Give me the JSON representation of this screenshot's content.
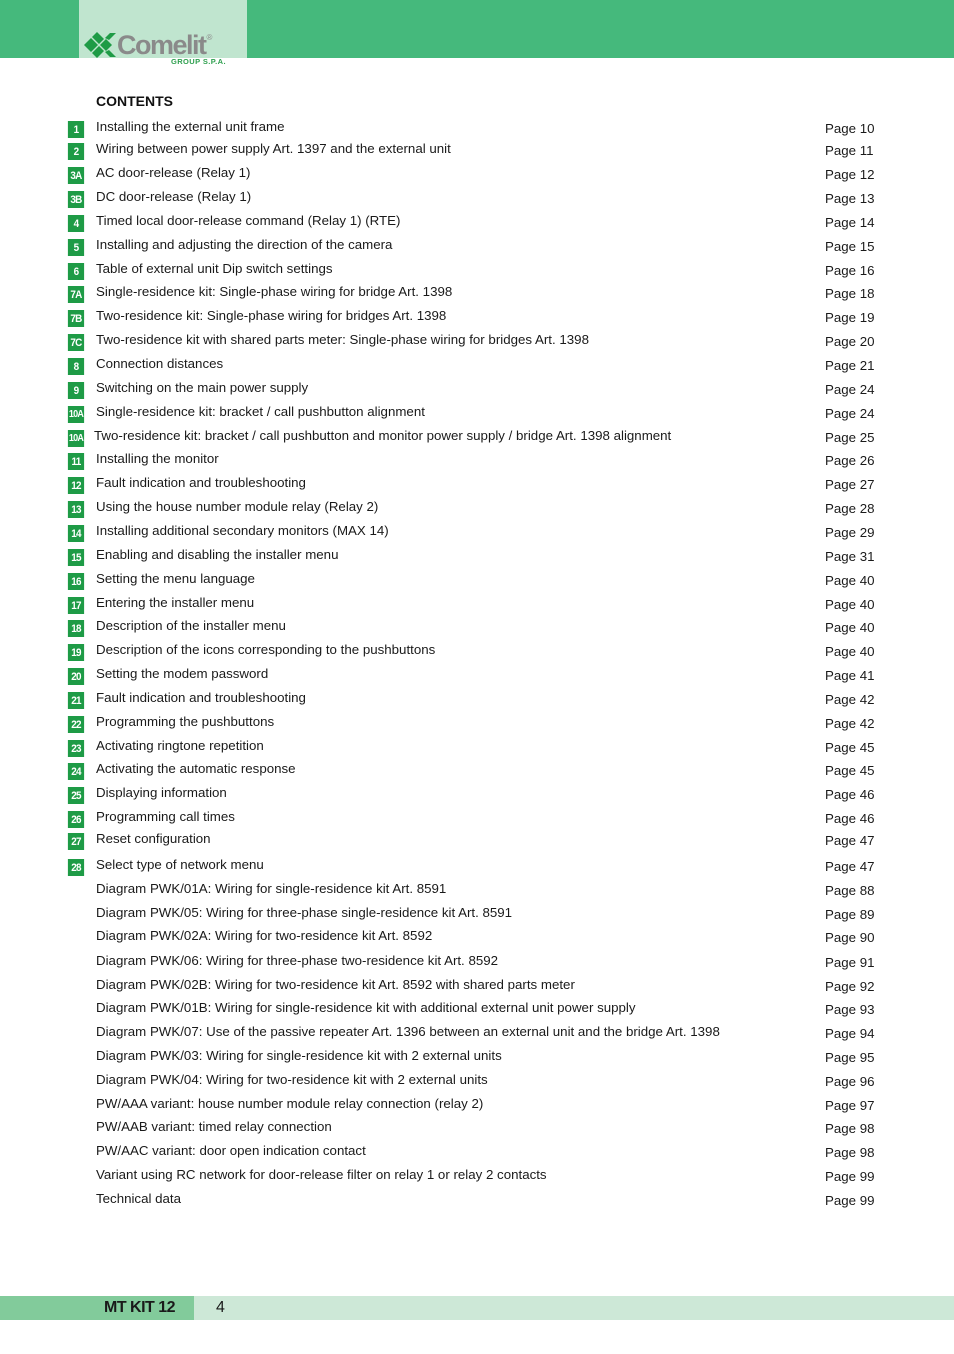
{
  "header": {
    "brand": "Comelit",
    "brand_mark": "®",
    "brand_sub": "GROUP S.P.A.",
    "colors": {
      "band": "#45b97c",
      "logo_bg": "#c0e5cf",
      "badge": "#1e9b46",
      "footer_dark": "#82cb9b",
      "footer_light": "#cde8d7"
    }
  },
  "contents": {
    "title": "CONTENTS",
    "entries": [
      {
        "num": "1",
        "title": "Installing the external unit frame",
        "page": "Page 10"
      },
      {
        "num": "2",
        "title": "Wiring between power supply Art. 1397 and the external unit",
        "page": "Page 11"
      },
      {
        "num": "3A",
        "title": "AC door-release (Relay 1)",
        "page": "Page 12"
      },
      {
        "num": "3B",
        "title": "DC door-release (Relay 1)",
        "page": "Page 13"
      },
      {
        "num": "4",
        "title": "Timed local door-release command (Relay 1) (RTE)",
        "page": "Page 14"
      },
      {
        "num": "5",
        "title": "Installing and adjusting the direction of the camera",
        "page": "Page 15"
      },
      {
        "num": "6",
        "title": "Table of external unit Dip switch settings",
        "page": "Page 16"
      },
      {
        "num": "7A",
        "title": "Single-residence kit: Single-phase wiring for bridge Art. 1398",
        "page": "Page 18"
      },
      {
        "num": "7B",
        "title": "Two-residence kit: Single-phase wiring for bridges Art. 1398",
        "page": "Page 19"
      },
      {
        "num": "7C",
        "title": "Two-residence kit with shared parts meter: Single-phase wiring for bridges Art. 1398",
        "page": "Page 20"
      },
      {
        "num": "8",
        "title": "Connection distances",
        "page": "Page 21"
      },
      {
        "num": "9",
        "title": "Switching on the main power supply",
        "page": "Page 24"
      },
      {
        "num": "10A",
        "title": "Single-residence kit: bracket / call pushbutton alignment",
        "page": "Page 24"
      },
      {
        "num": "10A",
        "title": "Two-residence kit: bracket / call pushbutton and monitor power supply / bridge Art. 1398 alignment",
        "page": "Page 25"
      },
      {
        "num": "11",
        "title": "Installing the monitor",
        "page": "Page 26"
      },
      {
        "num": "12",
        "title": "Fault indication and troubleshooting",
        "page": "Page 27"
      },
      {
        "num": "13",
        "title": "Using the house number module relay (Relay 2)",
        "page": "Page 28"
      },
      {
        "num": "14",
        "title": "Installing additional secondary monitors (MAX 14)",
        "page": "Page 29"
      },
      {
        "num": "15",
        "title": "Enabling and disabling the installer menu",
        "page": "Page 31"
      },
      {
        "num": "16",
        "title": "Setting the menu language",
        "page": "Page 40"
      },
      {
        "num": "17",
        "title": "Entering the installer menu",
        "page": "Page 40"
      },
      {
        "num": "18",
        "title": "Description of the installer menu",
        "page": "Page 40"
      },
      {
        "num": "19",
        "title": "Description of the icons corresponding to the pushbuttons",
        "page": "Page 40"
      },
      {
        "num": "20",
        "title": "Setting the modem password",
        "page": "Page 41"
      },
      {
        "num": "21",
        "title": "Fault indication and troubleshooting",
        "page": "Page 42"
      },
      {
        "num": "22",
        "title": "Programming the pushbuttons",
        "page": "Page 42"
      },
      {
        "num": "23",
        "title": "Activating ringtone repetition",
        "page": "Page 45"
      },
      {
        "num": "24",
        "title": "Activating the automatic response",
        "page": "Page 45"
      },
      {
        "num": "25",
        "title": "Displaying information",
        "page": "Page 46"
      },
      {
        "num": "26",
        "title": "Programming call times",
        "page": "Page 46"
      },
      {
        "num": "27",
        "title": "Reset configuration",
        "page": "Page 47"
      },
      {
        "num": "28",
        "title": "Select type of network menu",
        "page": "Page 47"
      },
      {
        "num": "",
        "title": "Diagram PWK/01A: Wiring for single-residence kit Art. 8591",
        "page": "Page 88"
      },
      {
        "num": "",
        "title": "Diagram PWK/05: Wiring for three-phase single-residence kit Art. 8591",
        "page": "Page 89"
      },
      {
        "num": "",
        "title": "Diagram PWK/02A: Wiring for two-residence kit Art. 8592",
        "page": "Page 90"
      },
      {
        "num": "",
        "title": "Diagram PWK/06: Wiring for three-phase two-residence kit Art. 8592",
        "page": "Page 91"
      },
      {
        "num": "",
        "title": "Diagram PWK/02B: Wiring for two-residence kit Art. 8592 with shared parts meter",
        "page": "Page 92"
      },
      {
        "num": "",
        "title": "Diagram PWK/01B: Wiring for single-residence kit with additional external unit power supply",
        "page": "Page 93"
      },
      {
        "num": "",
        "title": "Diagram PWK/07: Use of the passive repeater Art. 1396 between an external unit and the bridge Art. 1398",
        "page": "Page 94"
      },
      {
        "num": "",
        "title": "Diagram PWK/03: Wiring for single-residence kit with 2 external units",
        "page": "Page 95"
      },
      {
        "num": "",
        "title": "Diagram PWK/04: Wiring for two-residence kit with 2 external units",
        "page": "Page 96"
      },
      {
        "num": "",
        "title": "PW/AAA variant: house number module relay connection (relay 2)",
        "page": "Page 97"
      },
      {
        "num": "",
        "title": "PW/AAB variant: timed relay connection",
        "page": "Page 98"
      },
      {
        "num": "",
        "title": "PW/AAC variant: door open indication contact",
        "page": "Page 98"
      },
      {
        "num": "",
        "title": "Variant using RC network for door-release filter on relay 1 or relay 2 contacts",
        "page": "Page 99"
      },
      {
        "num": "",
        "title": "Technical data",
        "page": "Page 99"
      }
    ]
  },
  "footer": {
    "doc_title": "MT KIT 12",
    "page_number": "4"
  }
}
